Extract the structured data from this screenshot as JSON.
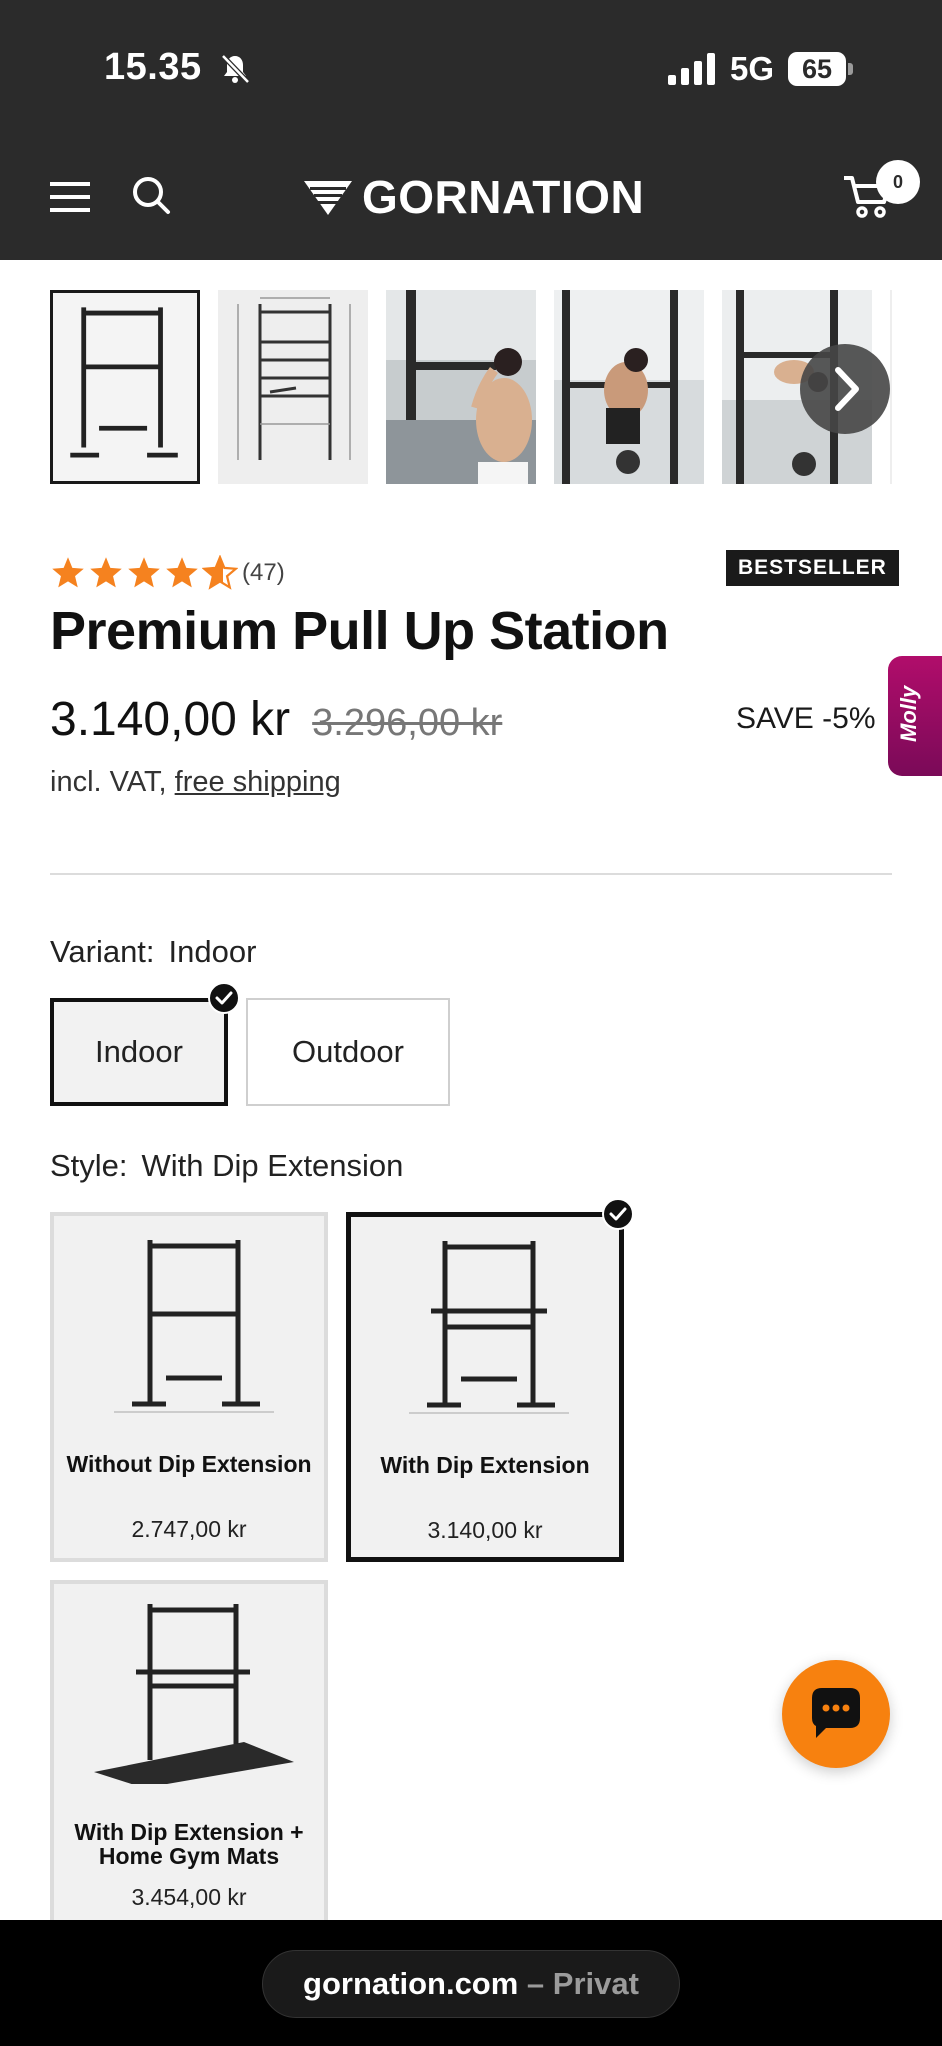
{
  "status_bar": {
    "time": "15.35",
    "network": "5G",
    "battery": "65"
  },
  "header": {
    "logo": "GORNATION",
    "cart_count": "0"
  },
  "gallery": {
    "thumbnails": [
      "Pull up station front view",
      "Pull up station dimensions",
      "Man doing pull ups",
      "Man doing dips",
      "Man doing leg raises"
    ]
  },
  "product": {
    "rating_count": "(47)",
    "badge": "BESTSELLER",
    "title": "Premium Pull Up Station",
    "price": "3.140,00 kr",
    "old_price": "3.296,00 kr",
    "save": "SAVE -5%",
    "vat_prefix": "incl. VAT,",
    "vat_link": "free shipping"
  },
  "molly": {
    "label": "Molly"
  },
  "variant": {
    "label": "Variant:",
    "selected": "Indoor",
    "options": [
      "Indoor",
      "Outdoor"
    ]
  },
  "style": {
    "label": "Style:",
    "selected": "With Dip Extension",
    "cards": [
      {
        "name": "Without Dip Extension",
        "price": "2.747,00 kr"
      },
      {
        "name": "With Dip Extension",
        "price": "3.140,00 kr"
      },
      {
        "name": "With Dip Extension + Home Gym Mats",
        "price": "3.454,00 kr"
      }
    ]
  },
  "browser": {
    "domain": "gornation.com",
    "separator": " – ",
    "mode": "Privat"
  },
  "colors": {
    "header_bg": "#2b2b2b",
    "star": "#f5821f",
    "chat": "#f7810f",
    "molly": "#b10d6b"
  },
  "icons": [
    "bell-slash-icon",
    "signal-icon",
    "menu-icon",
    "search-icon",
    "cart-icon",
    "chevron-right-icon",
    "check-icon",
    "star-icon",
    "chat-icon"
  ]
}
